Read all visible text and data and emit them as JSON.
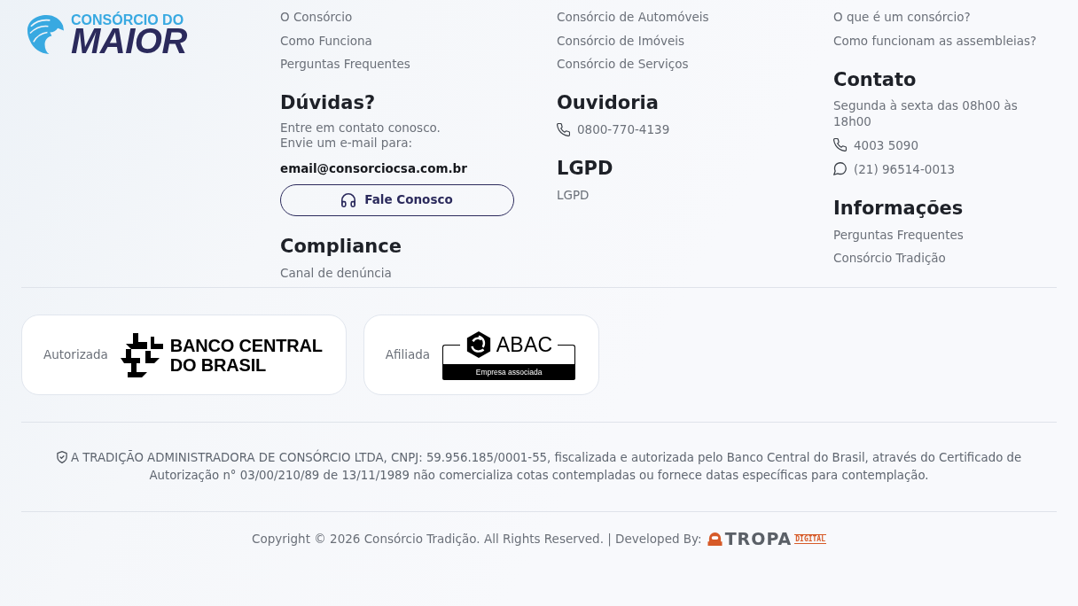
{
  "logo": {
    "tagline": "CONSÓRCIO DO",
    "name": "MAIOR"
  },
  "columns": [
    {
      "links": [
        "O Consórcio",
        "Como Funciona",
        "Perguntas Frequentes"
      ],
      "sections": [
        {
          "kind": "contact_email",
          "title": "Dúvidas?",
          "text": "Entre em contato conosco.\nEnvie um e-mail para:",
          "email": "email@consorciocsa.com.br",
          "button": "Fale Conosco"
        },
        {
          "kind": "links",
          "title": "Compliance",
          "links": [
            "Canal de denúncia"
          ]
        }
      ]
    },
    {
      "links": [
        "Consórcio de Automóveis",
        "Consórcio de Imóveis",
        "Consórcio de Serviços"
      ],
      "sections": [
        {
          "kind": "contacts",
          "title": "Ouvidoria",
          "contacts": [
            {
              "kind": "phone",
              "text": "0800-770-4139"
            }
          ]
        },
        {
          "kind": "links",
          "title": "LGPD",
          "links": [
            "LGPD"
          ]
        }
      ]
    },
    {
      "links": [
        "O que é um consórcio?",
        "Como funcionam as assembleias?"
      ],
      "sections": [
        {
          "kind": "contacts",
          "title": "Contato",
          "note": "Segunda à sexta das 08h00 às 18h00",
          "contacts": [
            {
              "kind": "phone",
              "text": "4003 5090"
            },
            {
              "kind": "chat",
              "text": "(21) 96514-0013"
            }
          ]
        },
        {
          "kind": "links",
          "title": "Informações",
          "links": [
            "Perguntas Frequentes",
            "Consórcio Tradição"
          ]
        }
      ]
    }
  ],
  "seals": [
    {
      "kind": "bcb",
      "label": "Autorizada",
      "logo_text": "BANCO CENTRAL\nDO BRASIL"
    },
    {
      "kind": "abac",
      "label": "Afiliada",
      "logo_text": "ABAC",
      "logo_caption": "Empresa associada"
    }
  ],
  "disclaimer": "A TRADIÇÃO ADMINISTRADORA DE CONSÓRCIO LTDA, CNPJ: 59.956.185/0001-55, fiscalizada e autorizada pelo Banco Central do Brasil, através do Certificado de Autorização n° 03/00/210/89 de 13/11/1989 não comercializa cotas contempladas ou fornece datas específicas para contemplação.",
  "copyright": {
    "text": "Copyright © 2026 Consórcio Tradição. All Rights Reserved. | Developed By:",
    "developer_logo": {
      "name": "TROPA",
      "tag": "DIGITAL"
    }
  }
}
